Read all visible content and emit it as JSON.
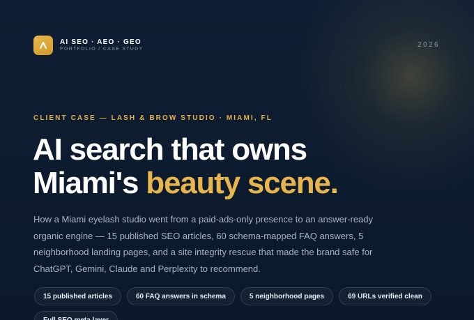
{
  "header": {
    "logo_icon": "chevron-up-icon",
    "brand_name": "AI SEO · AEO · GEO",
    "tagline": "PORTFOLIO / CASE STUDY",
    "year": "2026"
  },
  "hero": {
    "eyebrow": "CLIENT CASE — LASH & BROW STUDIO · MIAMI, FL",
    "headline_line1": "AI search that owns",
    "headline_line2_plain": "Miami's ",
    "headline_line2_accent": "beauty scene.",
    "intro": "How a Miami eyelash studio went from a paid-ads-only presence to an answer-ready organic engine — 15 published SEO articles, 60 schema-mapped FAQ answers, 5 neighborhood landing pages, and a site integrity rescue that made the brand safe for ChatGPT, Gemini, Claude and Perplexity to recommend."
  },
  "chips": [
    {
      "label": "15 published articles"
    },
    {
      "label": "60 FAQ answers in schema"
    },
    {
      "label": "5 neighborhood pages"
    },
    {
      "label": "69 URLs verified clean"
    },
    {
      "label": "Full SEO meta layer"
    }
  ],
  "colors": {
    "background": "#0d1b2f",
    "accent": "#e8b54d",
    "muted_text": "#a9b3c2"
  }
}
